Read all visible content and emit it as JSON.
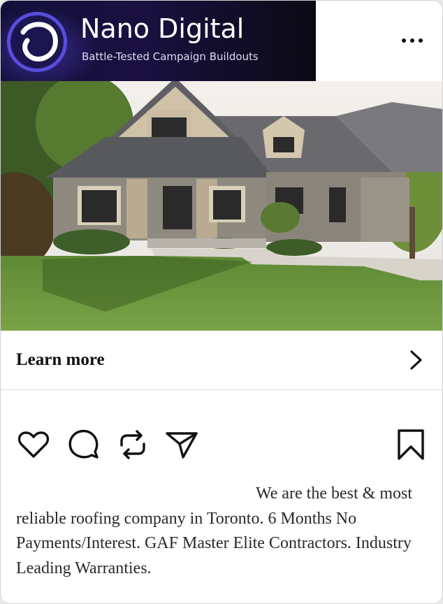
{
  "header": {
    "brand_name": "Nano Digital",
    "brand_tagline": "Battle-Tested Campaign Buildouts",
    "more_icon": "more-horizontal-icon"
  },
  "post": {
    "image_description_icon": "house-photo",
    "cta_label": "Learn more",
    "cta_icon": "chevron-right-icon",
    "caption": "We are the best & most reliable roofing company in Toronto. 6 Months No Payments/Interest. GAF Master Elite Contractors. Industry Leading Warranties."
  },
  "actions": {
    "like_icon": "heart-icon",
    "comment_icon": "comment-icon",
    "repost_icon": "repost-icon",
    "share_icon": "send-icon",
    "save_icon": "bookmark-icon"
  },
  "colors": {
    "brand_bg_start": "#12103a",
    "brand_bg_end": "#0b0a14",
    "text_dark": "#111111"
  }
}
